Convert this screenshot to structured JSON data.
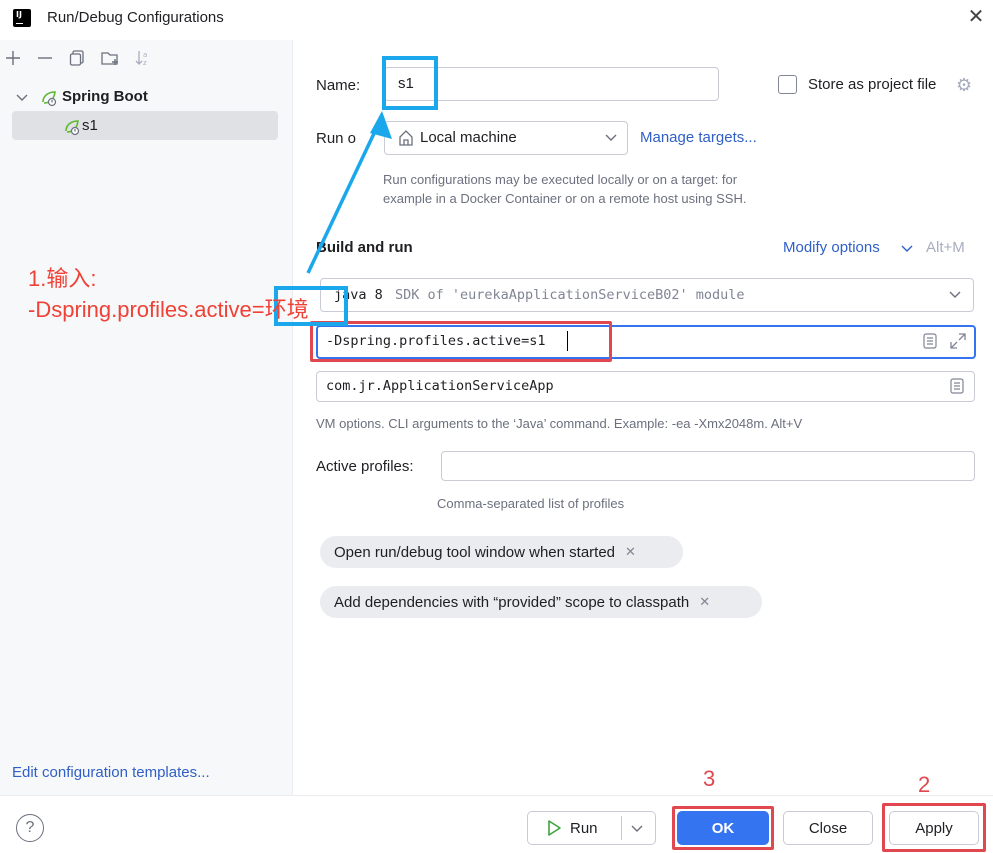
{
  "window": {
    "title": "Run/Debug Configurations",
    "logo_text": "IJ"
  },
  "toolbar": {
    "icons": [
      "plus-icon",
      "minus-icon",
      "copy-icon",
      "folder-add-icon",
      "sort-icon"
    ]
  },
  "tree": {
    "group_label": "Spring Boot",
    "config_label": "s1"
  },
  "left_footer": {
    "edit_templates": "Edit configuration templates..."
  },
  "form": {
    "name_label": "Name:",
    "name_value": "s1",
    "store_label": "Store as project file",
    "runon_label": "Run o",
    "runon_value": "Local machine",
    "manage_targets": "Manage targets...",
    "runon_hint_1": "Run configurations may be executed locally or on a target: for",
    "runon_hint_2": "example in a Docker Container or on a remote host using SSH.",
    "build_title": "Build and run",
    "modify_options": "Modify options",
    "modify_shortcut": "Alt+M",
    "jdk_java": "java 8",
    "jdk_rest": "SDK of 'eurekaApplicationServiceB02' module",
    "vm_options": "-Dspring.profiles.active=s1",
    "main_class": "com.jr.ApplicationServiceApp",
    "args_hint": "VM options. CLI arguments to the ‘Java’ command. Example: -ea -Xmx2048m. Alt+V",
    "profiles_label": "Active profiles:",
    "profiles_value": "",
    "profiles_hint": "Comma-separated list of profiles",
    "chip_1": "Open run/debug tool window when started",
    "chip_2": "Add dependencies with “provided” scope to classpath"
  },
  "footer": {
    "help": "?",
    "run": "Run",
    "ok": "OK",
    "close": "Close",
    "apply": "Apply"
  },
  "annotations": {
    "step1_line1": "1.输入:",
    "step1_line2": "-Dspring.profiles.active=环境",
    "step2": "2",
    "step3": "3"
  },
  "colors": {
    "accent": "#3574f0",
    "annotation_red": "#e0474e",
    "annotation_blue": "#1aa7ec",
    "link": "#2f5fc7"
  }
}
